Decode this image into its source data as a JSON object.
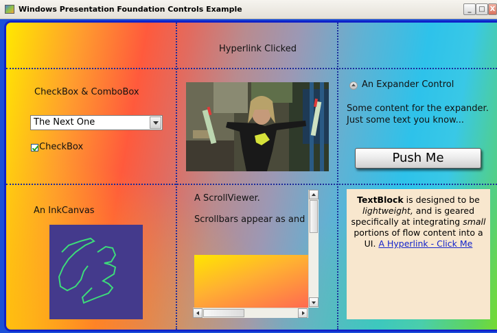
{
  "window": {
    "title": "Windows Presentation Foundation Controls Example",
    "buttons": {
      "minimize": "_",
      "maximize": "□",
      "close": "X"
    }
  },
  "hyperlink_status": "Hyperlink Clicked",
  "checkbox_combo": {
    "label": "CheckBox & ComboBox",
    "combo_selected": "The Next One",
    "checkbox_label": "CheckBox",
    "checkbox_checked": true
  },
  "expander": {
    "header": "An Expander Control",
    "content_line1": "Some content for the expander.",
    "content_line2": "Just some text you know..."
  },
  "push_button": {
    "label": "Push Me"
  },
  "ink_canvas": {
    "label": "An InkCanvas"
  },
  "scroll_viewer": {
    "title": "A ScrollViewer.",
    "text": "Scrollbars appear as and when needed"
  },
  "text_block": {
    "bold": "TextBlock",
    "t1": " is designed to be ",
    "italic1": "lightweight,",
    "t2": " and is geared specifically at integrating ",
    "italic2": "small",
    "t3": " portions of flow content into a UI. ",
    "link": "A Hyperlink - Click Me"
  },
  "colors": {
    "frame_blue": "#1a4fd8",
    "grid_dots": "#1b2a9a",
    "ink_background": "#443a8c",
    "ink_stroke": "#3ddc7a",
    "textblock_background": "#f8e7ce",
    "hyperlink": "#1122cc"
  }
}
